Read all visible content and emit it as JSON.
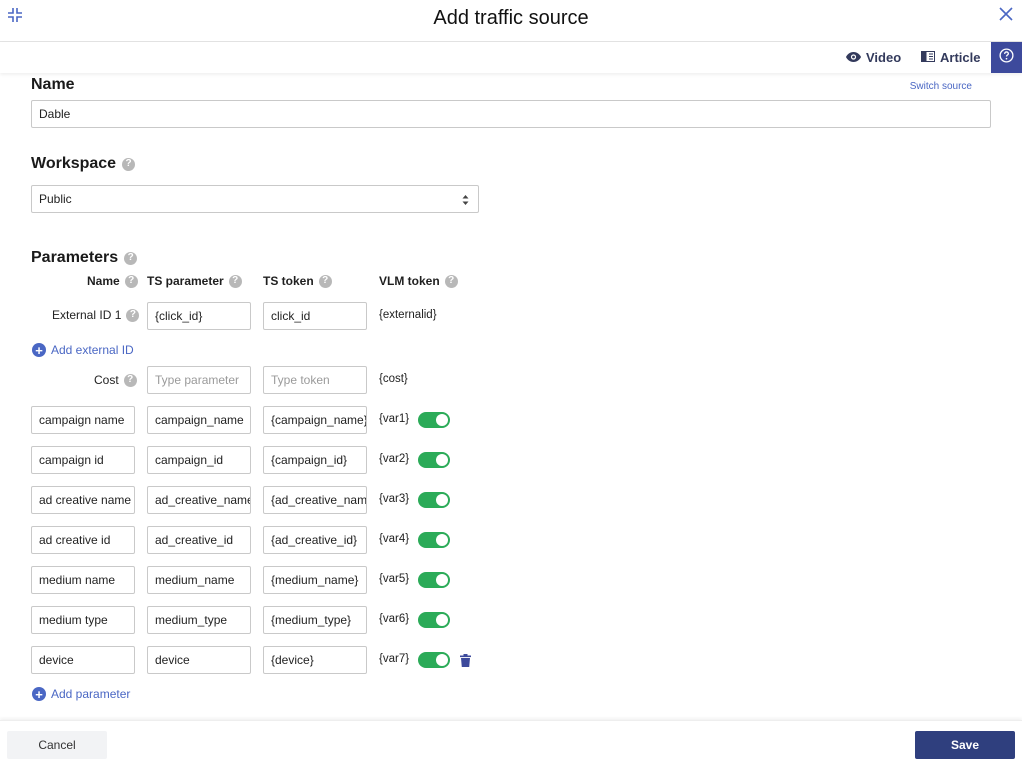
{
  "dialog": {
    "title": "Add traffic source"
  },
  "toolbar": {
    "video_label": "Video",
    "article_label": "Article"
  },
  "name_section": {
    "title": "Name",
    "switch_source": "Switch source",
    "value": "Dable"
  },
  "workspace": {
    "title": "Workspace",
    "selected": "Public"
  },
  "parameters": {
    "title": "Parameters",
    "columns": {
      "name": "Name",
      "ts_parameter": "TS parameter",
      "ts_token": "TS token",
      "vlm_token": "VLM token"
    },
    "external_id": {
      "label": "External ID 1",
      "ts_parameter": "{click_id}",
      "ts_token": "click_id",
      "vlm_token": "{externalid}"
    },
    "add_external_id": "Add external ID",
    "cost": {
      "label": "Cost",
      "ts_parameter_placeholder": "Type parameter",
      "ts_token_placeholder": "Type token",
      "vlm_token": "{cost}"
    },
    "custom": [
      {
        "name": "campaign name",
        "ts_parameter": "campaign_name",
        "ts_token": "{campaign_name}",
        "vlm_token": "{var1}",
        "enabled": true
      },
      {
        "name": "campaign id",
        "ts_parameter": "campaign_id",
        "ts_token": "{campaign_id}",
        "vlm_token": "{var2}",
        "enabled": true
      },
      {
        "name": "ad creative name",
        "ts_parameter": "ad_creative_name",
        "ts_token": "{ad_creative_name}",
        "vlm_token": "{var3}",
        "enabled": true
      },
      {
        "name": "ad creative id",
        "ts_parameter": "ad_creative_id",
        "ts_token": "{ad_creative_id}",
        "vlm_token": "{var4}",
        "enabled": true
      },
      {
        "name": "medium name",
        "ts_parameter": "medium_name",
        "ts_token": "{medium_name}",
        "vlm_token": "{var5}",
        "enabled": true
      },
      {
        "name": "medium type",
        "ts_parameter": "medium_type",
        "ts_token": "{medium_type}",
        "vlm_token": "{var6}",
        "enabled": true
      },
      {
        "name": "device",
        "ts_parameter": "device",
        "ts_token": "{device}",
        "vlm_token": "{var7}",
        "enabled": true
      }
    ],
    "add_parameter": "Add parameter"
  },
  "footer": {
    "cancel_label": "Cancel",
    "save_label": "Save"
  },
  "colors": {
    "accent": "#4a67c4",
    "toggle_on": "#2bab58",
    "primary": "#2f3f7e",
    "help_bg": "#3d4a9c"
  },
  "icons": [
    "collapse-icon",
    "close-icon",
    "eye-icon",
    "book-icon",
    "question-circle-icon",
    "help-icon",
    "select-arrows-icon",
    "plus-circle-icon",
    "trash-icon"
  ]
}
